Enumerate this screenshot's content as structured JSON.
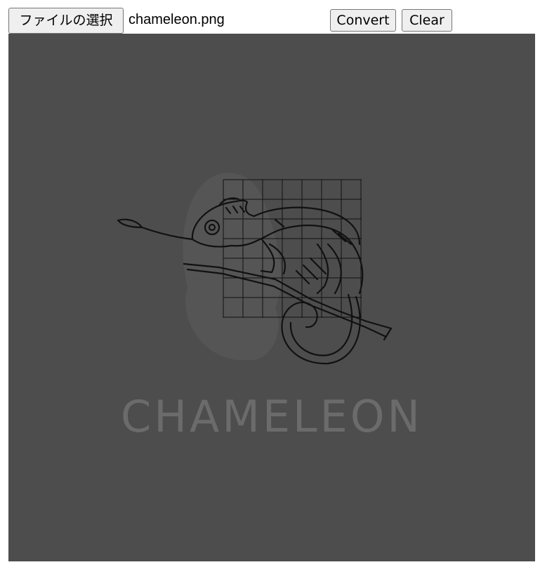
{
  "file_input": {
    "button_label": "ファイルの選択",
    "selected_file": "chameleon.png"
  },
  "actions": {
    "convert_label": "Convert",
    "clear_label": "Clear"
  },
  "preview": {
    "caption": "CHAMELEON",
    "background_color": "#4d4d4d",
    "caption_color": "#6b6b6b",
    "line_color": "#111111"
  }
}
